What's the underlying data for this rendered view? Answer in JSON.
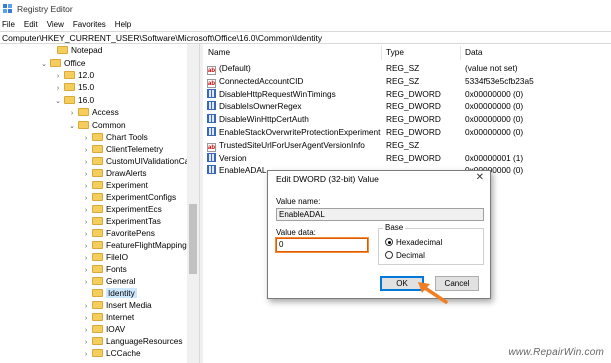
{
  "window": {
    "title": "Registry Editor"
  },
  "menu": [
    "File",
    "Edit",
    "View",
    "Favorites",
    "Help"
  ],
  "address": "Computer\\HKEY_CURRENT_USER\\Software\\Microsoft\\Office\\16.0\\Common\\Identity",
  "tree": {
    "items": [
      {
        "label": "Notepad"
      },
      {
        "label": "Office"
      },
      {
        "label": "12.0"
      },
      {
        "label": "15.0"
      },
      {
        "label": "16.0"
      },
      {
        "label": "Access"
      },
      {
        "label": "Common"
      },
      {
        "label": "Chart Tools"
      },
      {
        "label": "ClientTelemetry"
      },
      {
        "label": "CustomUIValidationCach"
      },
      {
        "label": "DrawAlerts"
      },
      {
        "label": "Experiment"
      },
      {
        "label": "ExperimentConfigs"
      },
      {
        "label": "ExperimentEcs"
      },
      {
        "label": "ExperimentTas"
      },
      {
        "label": "FavoritePens"
      },
      {
        "label": "FeatureFlightMapping"
      },
      {
        "label": "FileIO"
      },
      {
        "label": "Fonts"
      },
      {
        "label": "General"
      },
      {
        "label": "Identity"
      },
      {
        "label": "Insert Media"
      },
      {
        "label": "Internet"
      },
      {
        "label": "IOAV"
      },
      {
        "label": "LanguageResources"
      },
      {
        "label": "LCCache"
      }
    ],
    "selected": "Identity"
  },
  "values": {
    "headers": {
      "name": "Name",
      "type": "Type",
      "data": "Data"
    },
    "rows": [
      {
        "name": "(Default)",
        "type": "REG_SZ",
        "data": "(value not set)",
        "icon": "string-value-icon"
      },
      {
        "name": "ConnectedAccountCID",
        "type": "REG_SZ",
        "data": "5334f53e5cfb23a5",
        "icon": "string-value-icon"
      },
      {
        "name": "DisableHttpRequestWinTimings",
        "type": "REG_DWORD",
        "data": "0x00000000 (0)",
        "icon": "dword-value-icon"
      },
      {
        "name": "DisableIsOwnerRegex",
        "type": "REG_DWORD",
        "data": "0x00000000 (0)",
        "icon": "dword-value-icon"
      },
      {
        "name": "DisableWinHttpCertAuth",
        "type": "REG_DWORD",
        "data": "0x00000000 (0)",
        "icon": "dword-value-icon"
      },
      {
        "name": "EnableStackOverwriteProtectionExperiment",
        "type": "REG_DWORD",
        "data": "0x00000000 (0)",
        "icon": "dword-value-icon"
      },
      {
        "name": "TrustedSiteUrlForUserAgentVersionInfo",
        "type": "REG_SZ",
        "data": "",
        "icon": "string-value-icon"
      },
      {
        "name": "Version",
        "type": "REG_DWORD",
        "data": "0x00000001 (1)",
        "icon": "dword-value-icon"
      },
      {
        "name": "EnableADAL",
        "type": "",
        "data": "0x00000000 (0)",
        "icon": "dword-value-icon"
      }
    ]
  },
  "dialog": {
    "title": "Edit DWORD (32-bit) Value",
    "close": "✕",
    "value_name_label": "Value name:",
    "value_name": "EnableADAL",
    "value_data_label": "Value data:",
    "value_data": "0",
    "base_label": "Base",
    "radio_hex": "Hexadecimal",
    "radio_dec": "Decimal",
    "ok": "OK",
    "cancel": "Cancel",
    "highlight_color": "#f58b3a"
  },
  "watermark": "www.RepairWin.com"
}
